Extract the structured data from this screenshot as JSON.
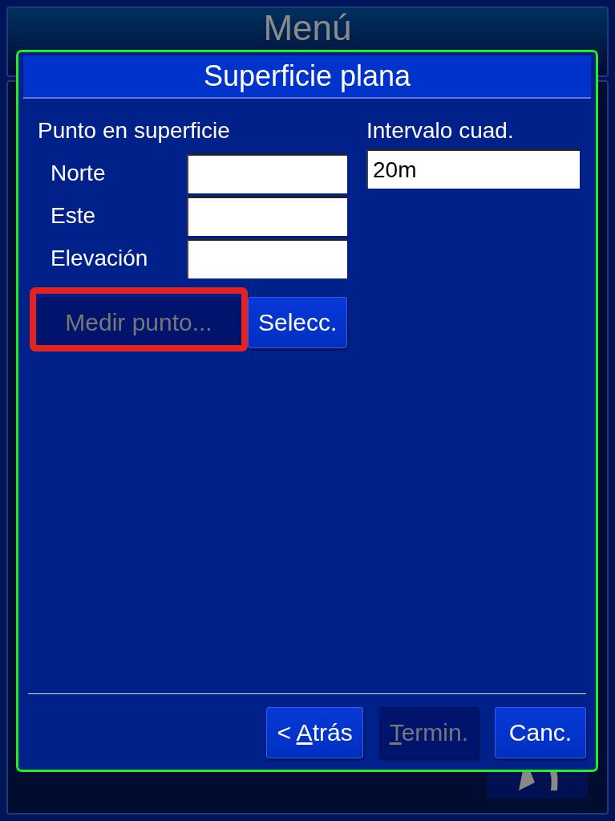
{
  "background": {
    "title": "Menú"
  },
  "dialog": {
    "title": "Superficie plana",
    "point": {
      "heading": "Punto en superficie",
      "fields": [
        {
          "label": "Norte"
        },
        {
          "label": "Este"
        },
        {
          "label": "Elevación"
        }
      ]
    },
    "interval": {
      "label": "Intervalo cuad.",
      "value": "20m"
    },
    "actions": [
      {
        "label": "Medir punto...",
        "disabled": true,
        "highlighted": true
      },
      {
        "label": "Selecc.",
        "disabled": false,
        "highlighted": false
      }
    ],
    "footer_buttons": [
      {
        "prefix": "< ",
        "access_key": "A",
        "text": "trás",
        "disabled": false
      },
      {
        "access_key": "T",
        "text": "ermin.",
        "disabled": true
      },
      {
        "text": "Canc.",
        "disabled": false
      }
    ]
  }
}
